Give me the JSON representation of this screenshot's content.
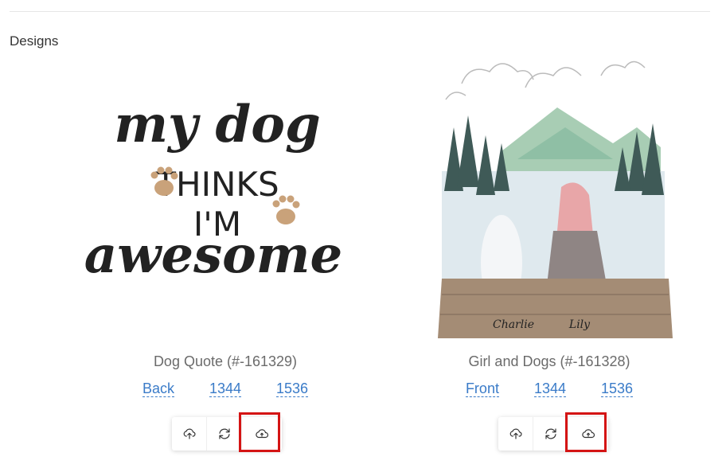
{
  "section": {
    "title": "Designs"
  },
  "designs": [
    {
      "title": "Dog Quote (#-161329)",
      "links": [
        "Back",
        "1344",
        "1536"
      ],
      "image_text": {
        "line1": "my dog",
        "line2": "THINKS",
        "line3": "I'M",
        "line4": "awesome"
      },
      "actions": [
        "upload-cloud-icon",
        "refresh-icon",
        "upload-cloud-icon"
      ],
      "highlighted_action": 2
    },
    {
      "title": "Girl and Dogs (#-161328)",
      "links": [
        "Front",
        "1344",
        "1536"
      ],
      "image_text": {
        "name1": "Charlie",
        "name2": "Lily"
      },
      "actions": [
        "upload-cloud-icon",
        "refresh-icon",
        "upload-cloud-icon"
      ],
      "highlighted_action": 2
    }
  ],
  "colors": {
    "link": "#3a7bc8",
    "highlight": "#d41414",
    "paw": "#c9a27a"
  }
}
